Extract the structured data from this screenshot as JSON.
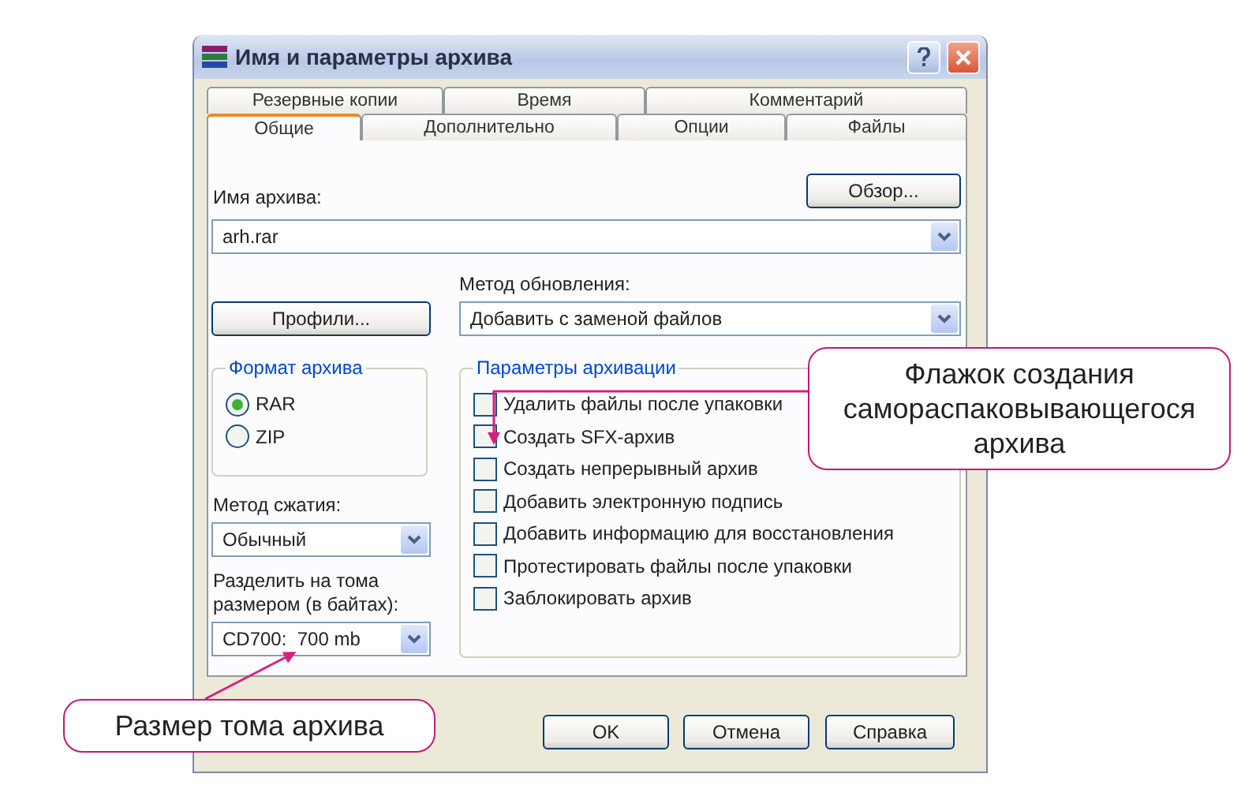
{
  "window": {
    "title": "Имя и параметры архива"
  },
  "tab_rows": [
    [
      {
        "label": "Резервные копии",
        "selected": false
      },
      {
        "label": "Время",
        "selected": false
      },
      {
        "label": "Комментарий",
        "selected": false
      }
    ],
    [
      {
        "label": "Общие",
        "selected": true
      },
      {
        "label": "Дополнительно",
        "selected": false
      },
      {
        "label": "Опции",
        "selected": false
      },
      {
        "label": "Файлы",
        "selected": false
      }
    ]
  ],
  "archive_name": {
    "label": "Имя архива:",
    "value": "arh.rar"
  },
  "browse_button": "Обзор...",
  "profiles_button": "Профили...",
  "update_method": {
    "label": "Метод обновления:",
    "value": "Добавить с заменой файлов"
  },
  "archive_format": {
    "title": "Формат архива",
    "options": [
      {
        "label": "RAR",
        "selected": true
      },
      {
        "label": "ZIP",
        "selected": false
      }
    ]
  },
  "compression_method": {
    "label": "Метод сжатия:",
    "value": "Обычный"
  },
  "split_volumes": {
    "label": "Разделить на тома размером (в байтах):",
    "value": "CD700:  700 mb"
  },
  "archive_options": {
    "title": "Параметры архивации",
    "items": [
      {
        "label": "Удалить файлы после упаковки",
        "checked": false
      },
      {
        "label": "Создать SFX-архив",
        "checked": false
      },
      {
        "label": "Создать непрерывный архив",
        "checked": false
      },
      {
        "label": "Добавить электронную подпись",
        "checked": false
      },
      {
        "label": "Добавить информацию для восстановления",
        "checked": false
      },
      {
        "label": "Протестировать файлы после упаковки",
        "checked": false
      },
      {
        "label": "Заблокировать архив",
        "checked": false
      }
    ]
  },
  "buttons": [
    "OK",
    "Отмена",
    "Справка"
  ],
  "callouts": [
    {
      "text": "Флажок создания самораспаковывающегося архива"
    },
    {
      "text": "Размер тома архива"
    }
  ]
}
